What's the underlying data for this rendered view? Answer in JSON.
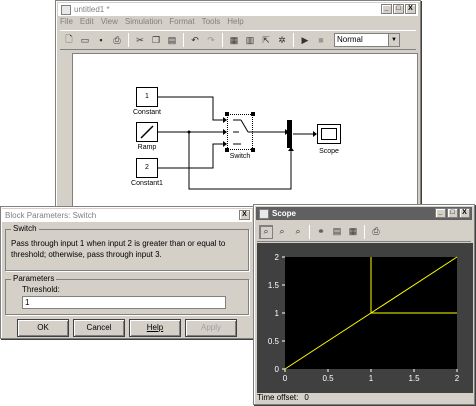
{
  "model_window": {
    "title": "untitled1 *",
    "caption_buttons": [
      "_",
      "□",
      "X"
    ],
    "menu": [
      "File",
      "Edit",
      "View",
      "Simulation",
      "Format",
      "Tools",
      "Help"
    ],
    "toolbar": {
      "icons": [
        "new-icon",
        "open-icon",
        "save-icon",
        "print-icon",
        "cut-icon",
        "copy-icon",
        "paste-icon",
        "undo-icon",
        "redo-icon",
        "library-browser-icon",
        "toggle-model-browser-icon",
        "go-to-parent-icon",
        "debug-icon",
        "start-simulation-icon",
        "stop-simulation-icon"
      ],
      "sim_mode": "Normal"
    },
    "blocks": {
      "constant_value": "1",
      "constant_label": "Constant",
      "ramp_label": "Ramp",
      "constant1_value": "2",
      "constant1_label": "Constant1",
      "switch_label": "Switch",
      "scope_label": "Scope"
    }
  },
  "dialog": {
    "title": "Block Parameters: Switch",
    "close": "X",
    "section_title": "Switch",
    "description": "Pass through input 1 when input 2 is greater than or equal to threshold; otherwise, pass through input 3.",
    "params_title": "Parameters",
    "threshold_label": "Threshold:",
    "threshold_value": "1",
    "buttons": {
      "ok": "OK",
      "cancel": "Cancel",
      "help": "Help",
      "apply": "Apply"
    }
  },
  "scope": {
    "title": "Scope",
    "caption_buttons": [
      "_",
      "□",
      "X"
    ],
    "toolbar_icons": [
      "zoom-icon",
      "zoom-x-icon",
      "zoom-y-icon",
      "autoscale-icon",
      "save-axes-icon",
      "parameters-icon",
      "print-icon"
    ],
    "time_offset_label": "Time offset:",
    "time_offset_value": "0",
    "plot": {
      "background": "#000000",
      "line_color": "#ffff00",
      "x_ticks": [
        "0",
        "0.5",
        "1",
        "1.5",
        "2"
      ],
      "y_ticks": [
        "0",
        "0.5",
        "1",
        "1.5",
        "2"
      ],
      "xlim": [
        0,
        2
      ],
      "ylim": [
        0,
        2
      ]
    }
  }
}
